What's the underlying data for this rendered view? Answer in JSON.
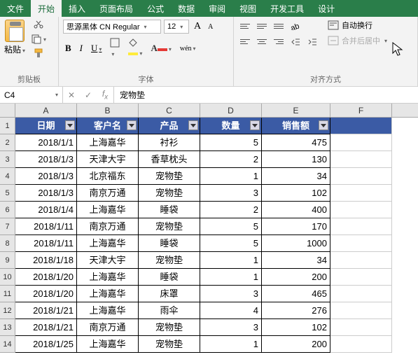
{
  "tabs": [
    "文件",
    "开始",
    "插入",
    "页面布局",
    "公式",
    "数据",
    "审阅",
    "视图",
    "开发工具",
    "设计"
  ],
  "active_tab": 1,
  "ribbon": {
    "clipboard": {
      "paste": "粘贴",
      "label": "剪贴板"
    },
    "font": {
      "name": "思源黑体 CN Regular",
      "size": "12",
      "grow": "A",
      "shrink": "A",
      "bold": "B",
      "italic": "I",
      "underline": "U",
      "pinyin": "wén",
      "label": "字体"
    },
    "align": {
      "wrap": "自动换行",
      "merge": "合并后居中",
      "label": "对齐方式"
    }
  },
  "namebox": "C4",
  "formula": "宠物垫",
  "columns": [
    "A",
    "B",
    "C",
    "D",
    "E",
    "F"
  ],
  "headers": [
    "日期",
    "客户名",
    "产品",
    "数量",
    "销售额"
  ],
  "rows": [
    [
      "2018/1/1",
      "上海嘉华",
      "衬衫",
      "5",
      "475"
    ],
    [
      "2018/1/3",
      "天津大宇",
      "香草枕头",
      "2",
      "130"
    ],
    [
      "2018/1/3",
      "北京福东",
      "宠物垫",
      "1",
      "34"
    ],
    [
      "2018/1/3",
      "南京万通",
      "宠物垫",
      "3",
      "102"
    ],
    [
      "2018/1/4",
      "上海嘉华",
      "睡袋",
      "2",
      "400"
    ],
    [
      "2018/1/11",
      "南京万通",
      "宠物垫",
      "5",
      "170"
    ],
    [
      "2018/1/11",
      "上海嘉华",
      "睡袋",
      "5",
      "1000"
    ],
    [
      "2018/1/18",
      "天津大宇",
      "宠物垫",
      "1",
      "34"
    ],
    [
      "2018/1/20",
      "上海嘉华",
      "睡袋",
      "1",
      "200"
    ],
    [
      "2018/1/20",
      "上海嘉华",
      "床罩",
      "3",
      "465"
    ],
    [
      "2018/1/21",
      "上海嘉华",
      "雨伞",
      "4",
      "276"
    ],
    [
      "2018/1/21",
      "南京万通",
      "宠物垫",
      "3",
      "102"
    ],
    [
      "2018/1/25",
      "上海嘉华",
      "宠物垫",
      "1",
      "200"
    ]
  ],
  "colors": {
    "tabbar": "#2a7e4a",
    "table_header": "#3b5ba5"
  }
}
